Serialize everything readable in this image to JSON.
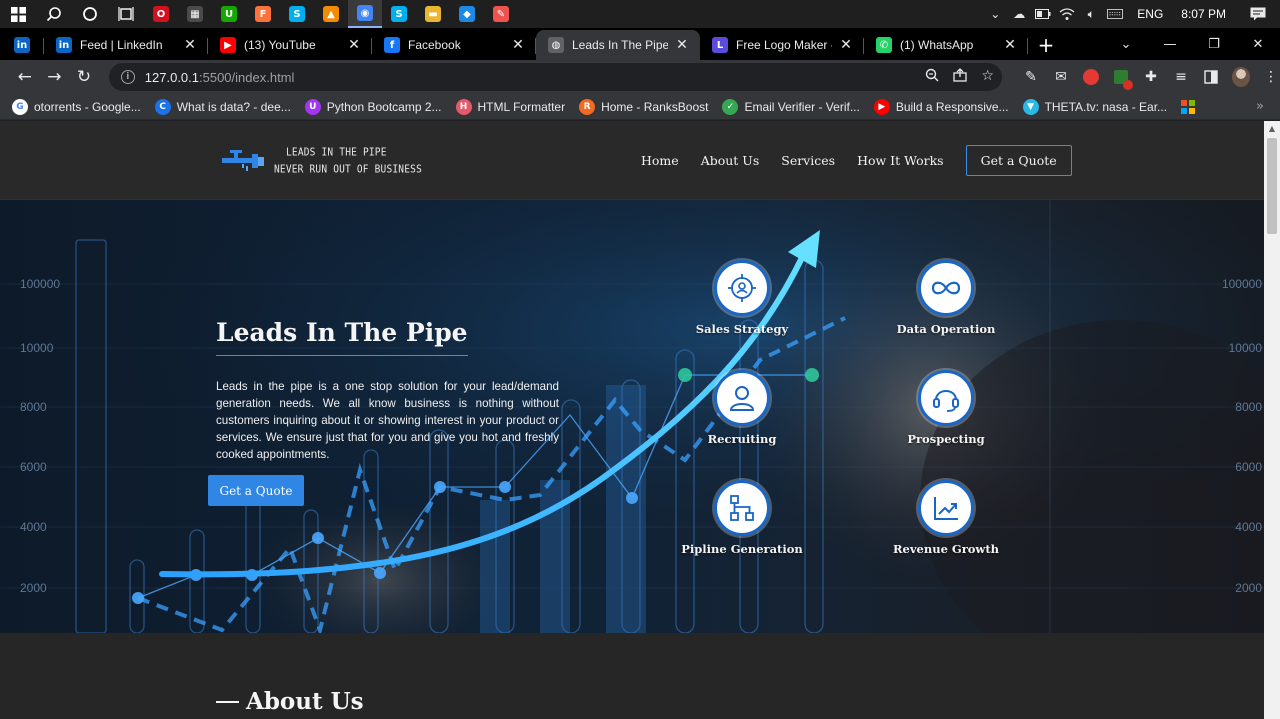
{
  "taskbar": {
    "apps": [
      {
        "name": "opera",
        "color": "#d3101c",
        "glyph": "O"
      },
      {
        "name": "calculator",
        "color": "#4a4a4a",
        "glyph": "▦"
      },
      {
        "name": "upwork",
        "color": "#14a800",
        "glyph": "U"
      },
      {
        "name": "firefox",
        "color": "#ff7139",
        "glyph": "F"
      },
      {
        "name": "skype",
        "color": "#00aff0",
        "glyph": "S"
      },
      {
        "name": "vlc",
        "color": "#f48b00",
        "glyph": "▲"
      },
      {
        "name": "chrome",
        "color": "#4285f4",
        "glyph": "◉"
      },
      {
        "name": "skype-2",
        "color": "#00aff0",
        "glyph": "S"
      },
      {
        "name": "file-explorer",
        "color": "#e8b632",
        "glyph": "▬"
      },
      {
        "name": "vscode",
        "color": "#1e88e5",
        "glyph": "◆"
      },
      {
        "name": "paint",
        "color": "#ef5350",
        "glyph": "✎"
      }
    ],
    "language": "ENG",
    "time": "8:07 PM"
  },
  "tabs": [
    {
      "title": "Feed | LinkedIn",
      "favicon": "linkedin-icon",
      "color": "#0a66c2",
      "glyph": "in"
    },
    {
      "title": "(13) YouTube",
      "favicon": "youtube-icon",
      "color": "#ff0000",
      "glyph": "▶"
    },
    {
      "title": "Facebook",
      "favicon": "facebook-icon",
      "color": "#1877f2",
      "glyph": "f"
    },
    {
      "title": "Leads In The Pipe | H",
      "favicon": "globe-icon",
      "color": "#5f6368",
      "glyph": "◍",
      "active": true
    },
    {
      "title": "Free Logo Maker - G",
      "favicon": "logo-maker-icon",
      "color": "#5b4bdb",
      "glyph": "L"
    },
    {
      "title": "(1) WhatsApp",
      "favicon": "whatsapp-icon",
      "color": "#25d366",
      "glyph": "✆"
    }
  ],
  "address_bar": {
    "host": "127.0.0.1",
    "path": ":5500/index.html"
  },
  "bookmarks": [
    {
      "label": "otorrents - Google...",
      "icon": "google-icon",
      "color": "#ffffff",
      "glyph": "G",
      "fg": "#4285f4"
    },
    {
      "label": "What is data? - dee...",
      "icon": "c-icon",
      "color": "#1a73e8",
      "glyph": "C",
      "fg": "#ffffff"
    },
    {
      "label": "Python Bootcamp 2...",
      "icon": "udemy-icon",
      "color": "#a435f0",
      "glyph": "U",
      "fg": "#ffffff"
    },
    {
      "label": "HTML Formatter",
      "icon": "formatter-icon",
      "color": "#e55a6a",
      "glyph": "H",
      "fg": "#ffffff"
    },
    {
      "label": "Home - RanksBoost",
      "icon": "ranksboost-icon",
      "color": "#f26b21",
      "glyph": "R",
      "fg": "#ffffff"
    },
    {
      "label": "Email Verifier - Verif...",
      "icon": "check-icon",
      "color": "#34a853",
      "glyph": "✓",
      "fg": "#ffffff"
    },
    {
      "label": "Build a Responsive...",
      "icon": "youtube-icon",
      "color": "#ff0000",
      "glyph": "▶",
      "fg": "#ffffff"
    },
    {
      "label": "THETA.tv: nasa - Ear...",
      "icon": "theta-icon",
      "color": "#2ab8e6",
      "glyph": "▼",
      "fg": "#ffffff"
    }
  ],
  "site": {
    "logo": {
      "line1": "Leads in the pipe",
      "line2": "Never run out of business"
    },
    "nav": [
      "Home",
      "About Us",
      "Services",
      "How It Works"
    ],
    "nav_cta": "Get a Quote",
    "hero": {
      "title": "Leads In The Pipe",
      "description": "Leads in the pipe is a one stop solution for your lead/demand generation needs. We all know business is nothing without customers inquiring about it or showing interest in your product or services. We ensure just that for you and give you hot and freshly cooked appointments.",
      "button": "Get a Quote",
      "axis_labels": [
        "100000",
        "10000",
        "8000",
        "6000",
        "4000",
        "2000"
      ]
    },
    "services": [
      {
        "label": "Sales Strategy",
        "icon": "target-icon"
      },
      {
        "label": "Data Operation",
        "icon": "infinity-icon"
      },
      {
        "label": "Recruiting",
        "icon": "person-icon"
      },
      {
        "label": "Prospecting",
        "icon": "headset-icon"
      },
      {
        "label": "Pipline Generation",
        "icon": "flowchart-icon"
      },
      {
        "label": "Revenue Growth",
        "icon": "growth-chart-icon"
      }
    ],
    "about_title": "About Us"
  },
  "colors": {
    "accent": "#2f86e4",
    "service_ring": "#1a66c5",
    "page_bg": "#262626"
  }
}
